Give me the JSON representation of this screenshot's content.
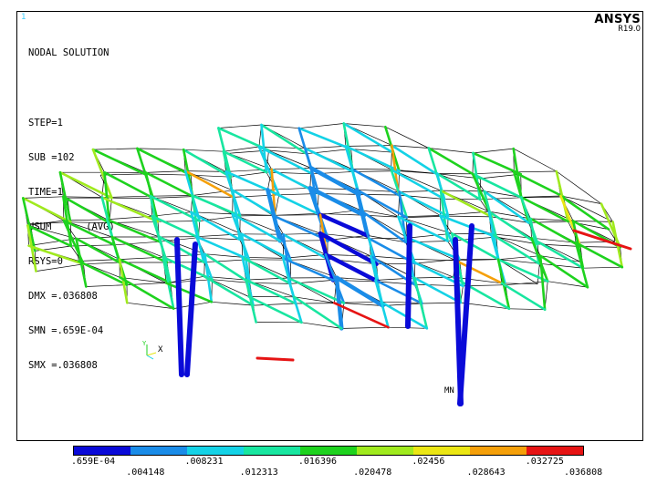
{
  "window_number": "1",
  "brand": {
    "name": "ANSYS",
    "version": "R19.0"
  },
  "info_lines": [
    "NODAL SOLUTION",
    "",
    "STEP=1",
    "SUB =102",
    "TIME=1",
    "USUM      (AVG)",
    "RSYS=0",
    "DMX =.036808",
    "SMN =.659E-04",
    "SMX =.036808"
  ],
  "markers": {
    "min_label": "MN",
    "axis_label": "X",
    "axis_y_label": "Y"
  },
  "legend": {
    "colors": [
      "#0a0ad8",
      "#1a8ce8",
      "#14d2e6",
      "#18e6a0",
      "#1ed21e",
      "#a0ea1e",
      "#ebe614",
      "#f5a00a",
      "#e61414"
    ],
    "top_labels": [
      ".659E-04",
      ".008231",
      ".016396",
      ".02456",
      ".032725"
    ],
    "bottom_labels": [
      ".004148",
      ".012313",
      ".020478",
      ".028643",
      ".036808"
    ]
  }
}
